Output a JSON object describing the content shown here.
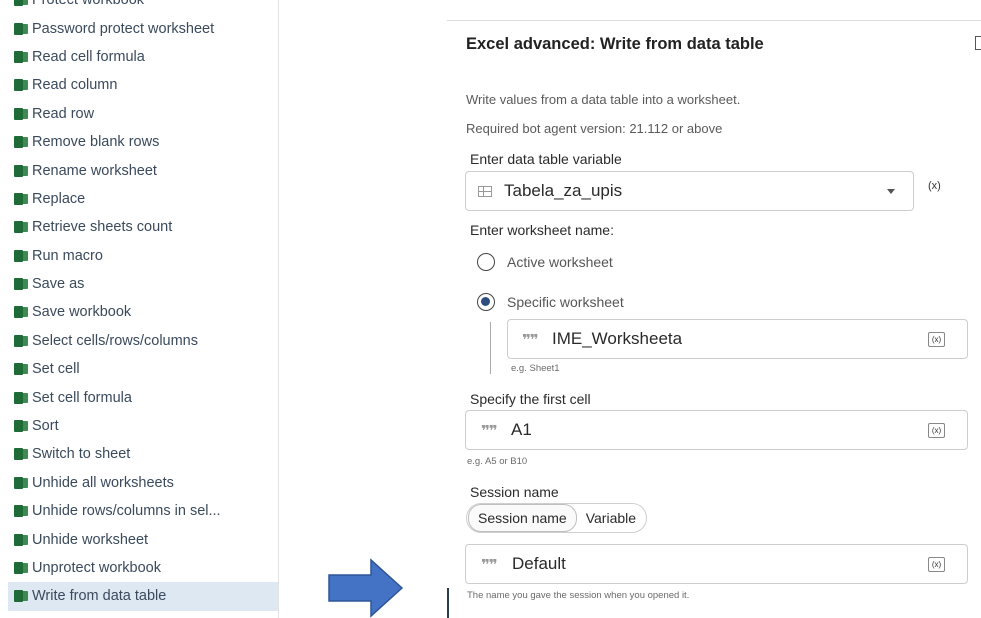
{
  "action_list": {
    "items": [
      {
        "label": "Protect workbook"
      },
      {
        "label": "Password protect worksheet"
      },
      {
        "label": "Read cell formula"
      },
      {
        "label": "Read column"
      },
      {
        "label": "Read row"
      },
      {
        "label": "Remove blank rows"
      },
      {
        "label": "Rename worksheet"
      },
      {
        "label": "Replace"
      },
      {
        "label": "Retrieve sheets count"
      },
      {
        "label": "Run macro"
      },
      {
        "label": "Save as"
      },
      {
        "label": "Save workbook"
      },
      {
        "label": "Select cells/rows/columns"
      },
      {
        "label": "Set cell"
      },
      {
        "label": "Set cell formula"
      },
      {
        "label": "Sort"
      },
      {
        "label": "Switch to sheet"
      },
      {
        "label": "Unhide all worksheets"
      },
      {
        "label": "Unhide rows/columns in sel..."
      },
      {
        "label": "Unhide worksheet"
      },
      {
        "label": "Unprotect workbook"
      },
      {
        "label": "Write from data table"
      }
    ],
    "selected_index": 21,
    "icon": "excel-icon"
  },
  "panel": {
    "title": "Excel advanced: Write from data table",
    "description": "Write values from a data table into a worksheet.",
    "version_note": "Required bot agent version: 21.112 or above",
    "data_table": {
      "label": "Enter data table variable",
      "value": "Tabela_za_upis",
      "var_symbol": "(x)"
    },
    "worksheet": {
      "label": "Enter worksheet name:",
      "option_active": "Active worksheet",
      "option_specific": "Specific worksheet",
      "selected": "specific",
      "value": "IME_Worksheeta",
      "hint": "e.g. Sheet1",
      "var_button": "(x)"
    },
    "first_cell": {
      "label": "Specify the first cell",
      "value": "A1",
      "hint": "e.g. A5 or B10",
      "var_button": "(x)"
    },
    "session": {
      "label": "Session name",
      "toggle_session": "Session name",
      "toggle_variable": "Variable",
      "active_toggle": "Session name",
      "value": "Default",
      "hint": "The name you gave the session when you opened it.",
      "var_button": "(x)"
    }
  },
  "colors": {
    "selected_row": "#dde8f3",
    "arrow_fill": "#4472c4",
    "excel_green": "#1f6b38",
    "radio_checked": "#2d4e7e"
  }
}
